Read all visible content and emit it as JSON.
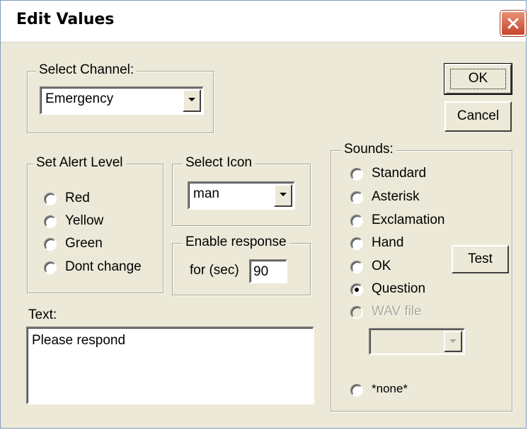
{
  "window": {
    "title": "Edit Values"
  },
  "buttons": {
    "ok": "OK",
    "cancel": "Cancel",
    "test": "Test"
  },
  "channel": {
    "legend": "Select Channel:",
    "value": "Emergency"
  },
  "alert": {
    "legend": "Set Alert Level",
    "options": [
      "Red",
      "Yellow",
      "Green",
      "Dont change"
    ],
    "selected": null
  },
  "icon": {
    "legend": "Select Icon",
    "value": "man"
  },
  "response": {
    "legend": "Enable response",
    "label": "for (sec)",
    "value": "90"
  },
  "text": {
    "label": "Text:",
    "value": "Please respond"
  },
  "sounds": {
    "legend": "Sounds:",
    "options": [
      "Standard",
      "Asterisk",
      "Exclamation",
      "Hand",
      "OK",
      "Question",
      "WAV file",
      "*none*"
    ],
    "selected": "Question",
    "disabled": [
      "WAV file"
    ]
  },
  "colors": {
    "dialog_bg": "#ece9d8",
    "close_button": "#c8432c"
  }
}
